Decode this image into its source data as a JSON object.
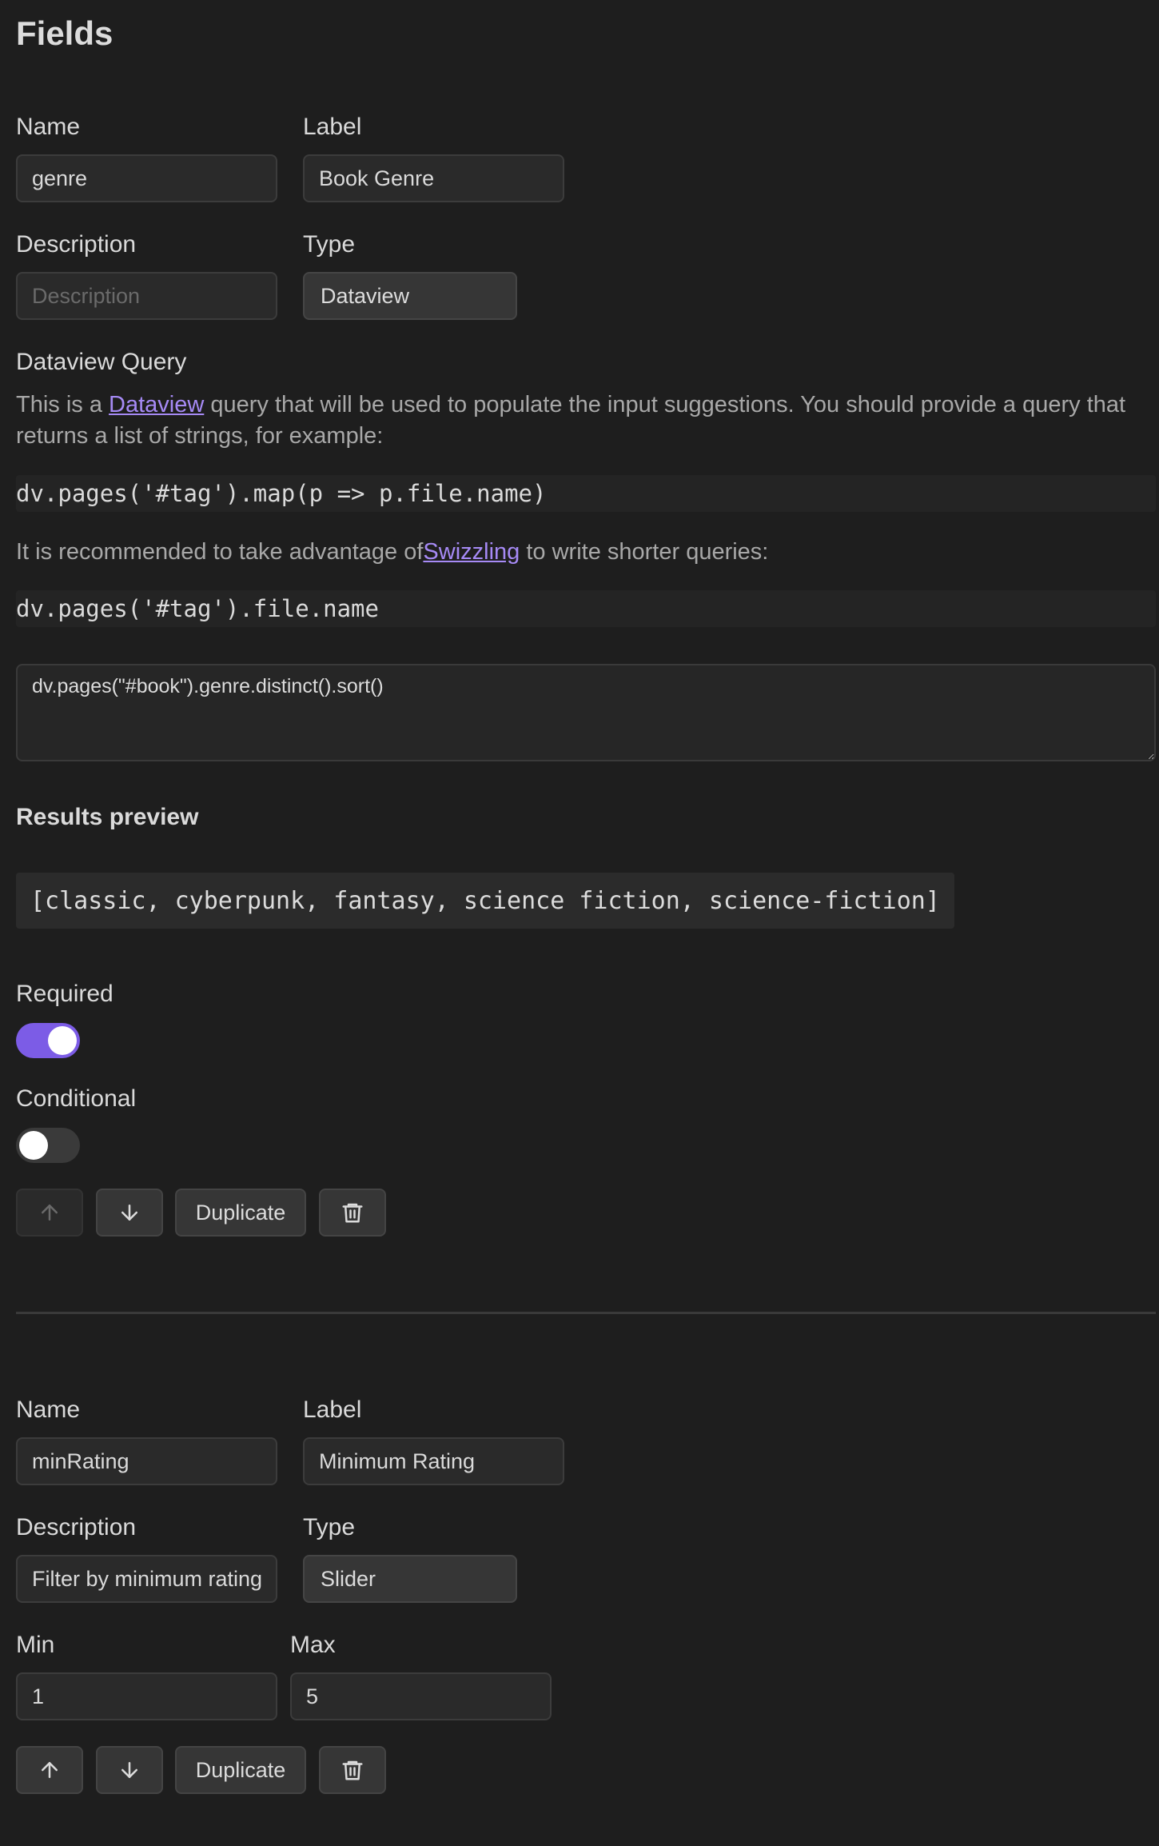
{
  "header": {
    "title": "Fields"
  },
  "field1": {
    "name_label": "Name",
    "name_value": "genre",
    "label_label": "Label",
    "label_value": "Book Genre",
    "description_label": "Description",
    "description_placeholder": "Description",
    "type_label": "Type",
    "type_value": "Dataview",
    "query_heading": "Dataview Query",
    "help_text_1": "This is a ",
    "help_link_1": "Dataview",
    "help_text_2": " query that will be used to populate the input suggestions. You should provide a query that returns a list of strings, for example:",
    "code_example_1": "dv.pages('#tag').map(p => p.file.name)",
    "help_text_3": "It is recommended to take advantage of",
    "help_link_2": "Swizzling",
    "help_text_4": " to write shorter queries:",
    "code_example_2": "dv.pages('#tag').file.name",
    "query_value": "dv.pages(\"#book\").genre.distinct().sort()",
    "results_heading": "Results preview",
    "results_value": "[classic, cyberpunk, fantasy, science fiction, science-fiction]",
    "required_label": "Required",
    "required_on": true,
    "conditional_label": "Conditional",
    "conditional_on": false,
    "duplicate_label": "Duplicate",
    "up_icon": "arrow-up-icon",
    "down_icon": "arrow-down-icon",
    "delete_icon": "trash-icon"
  },
  "field2": {
    "name_label": "Name",
    "name_value": "minRating",
    "label_label": "Label",
    "label_value": "Minimum Rating",
    "description_label": "Description",
    "description_value": "Filter by minimum rating",
    "type_label": "Type",
    "type_value": "Slider",
    "min_label": "Min",
    "min_value": "1",
    "max_label": "Max",
    "max_value": "5",
    "duplicate_label": "Duplicate"
  },
  "colors": {
    "accent": "#7c5ce6",
    "link": "#a68af5",
    "background": "#1e1e1e"
  }
}
